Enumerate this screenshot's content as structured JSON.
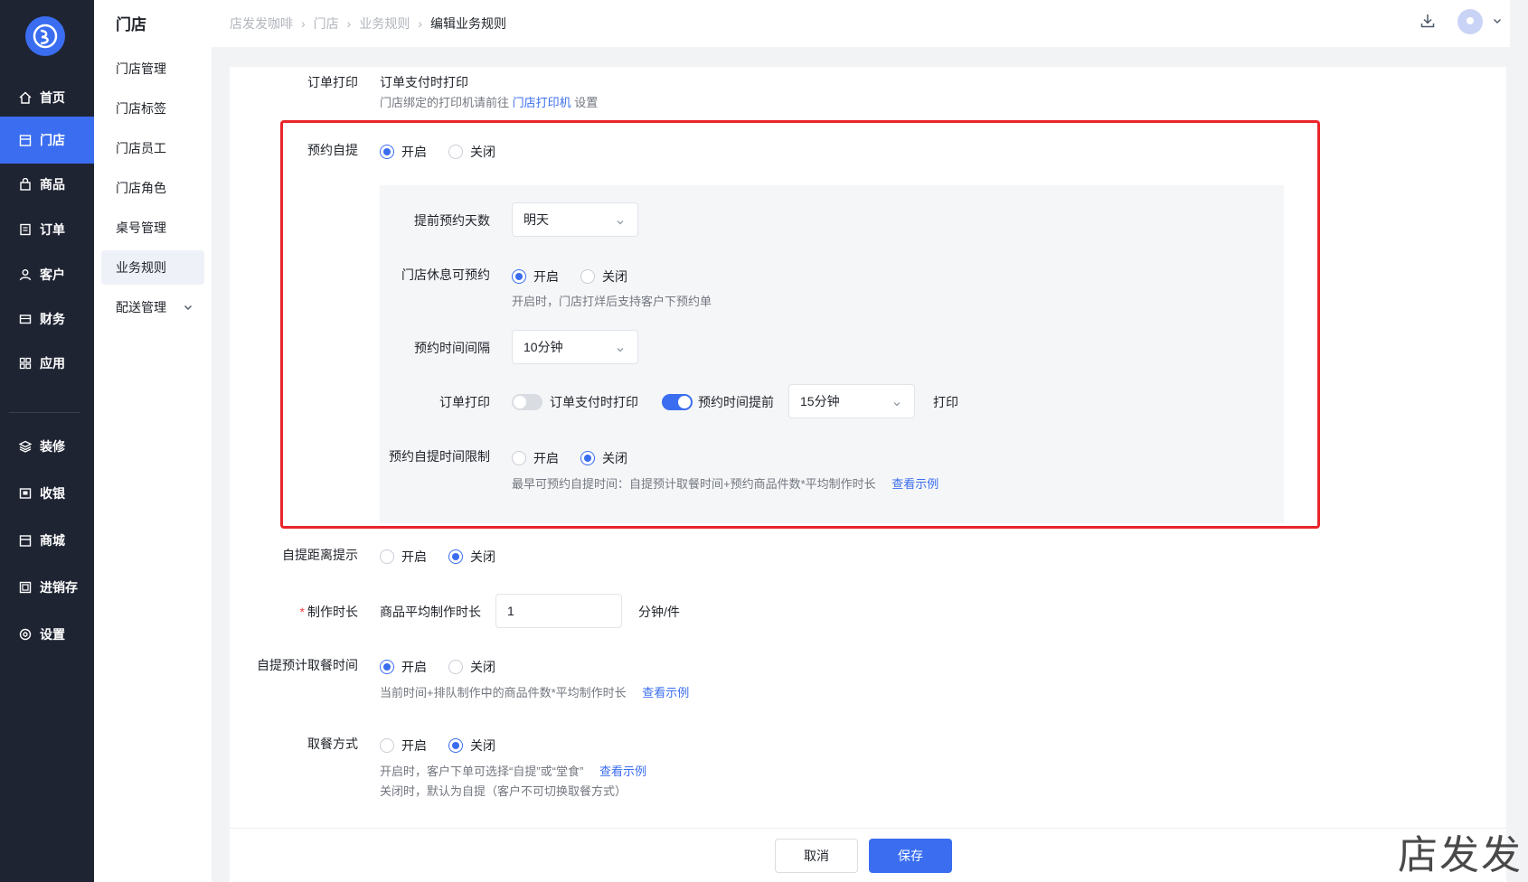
{
  "nav": {
    "items": [
      {
        "label": "首页",
        "icon": "home-icon"
      },
      {
        "label": "门店",
        "icon": "store-icon",
        "active": true
      },
      {
        "label": "商品",
        "icon": "bag-icon"
      },
      {
        "label": "订单",
        "icon": "order-icon"
      },
      {
        "label": "客户",
        "icon": "user-icon"
      },
      {
        "label": "财务",
        "icon": "wallet-icon"
      },
      {
        "label": "应用",
        "icon": "apps-icon"
      },
      {
        "label": "装修",
        "icon": "layers-icon"
      },
      {
        "label": "收银",
        "icon": "cashier-icon"
      },
      {
        "label": "商城",
        "icon": "shop-icon"
      },
      {
        "label": "进销存",
        "icon": "inventory-icon"
      },
      {
        "label": "设置",
        "icon": "settings-icon"
      }
    ]
  },
  "submenu": {
    "title": "门店",
    "items": [
      "门店管理",
      "门店标签",
      "门店员工",
      "门店角色",
      "桌号管理",
      "业务规则",
      "配送管理"
    ]
  },
  "breadcrumb": [
    "店发发咖啡",
    "门店",
    "业务规则",
    "编辑业务规则"
  ],
  "form": {
    "order_print": {
      "label": "订单打印",
      "value": "订单支付时打印",
      "hint_prefix": "门店绑定的打印机请前往",
      "hint_link": "门店打印机",
      "hint_suffix": "设置"
    },
    "reservation": {
      "label": "预约自提",
      "on": "开启",
      "off": "关闭",
      "advance_days_label": "提前预约天数",
      "advance_days_value": "明天",
      "rest_label": "门店休息可预约",
      "rest_hint": "开启时，门店打烊后支持客户下预约单",
      "interval_label": "预约时间间隔",
      "interval_value": "10分钟",
      "print_label": "订单打印",
      "print_opt1": "订单支付时打印",
      "print_opt2": "预约时间提前",
      "print_advance_value": "15分钟",
      "print_suffix": "打印",
      "limit_label": "预约自提时间限制",
      "limit_hint": "最早可预约自提时间：自提预计取餐时间+预约商品件数*平均制作时长",
      "limit_link": "查看示例"
    },
    "distance": {
      "label": "自提距离提示",
      "on": "开启",
      "off": "关闭"
    },
    "make_time": {
      "label": "制作时长",
      "prefix": "商品平均制作时长",
      "value": "1",
      "unit": "分钟/件"
    },
    "pickup_time": {
      "label": "自提预计取餐时间",
      "on": "开启",
      "off": "关闭",
      "hint": "当前时间+排队制作中的商品件数*平均制作时长",
      "link": "查看示例"
    },
    "pickup_mode": {
      "label": "取餐方式",
      "on": "开启",
      "off": "关闭",
      "hint1": "开启时，客户下单可选择“自提”或“堂食”",
      "link": "查看示例",
      "hint2": "关闭时，默认为自提（客户不可切换取餐方式）"
    }
  },
  "footer": {
    "cancel": "取消",
    "save": "保存"
  },
  "watermark": "店发发",
  "colors": {
    "accent": "#3a6df0",
    "nav_bg": "#1f2433",
    "highlight": "#e8262b"
  }
}
